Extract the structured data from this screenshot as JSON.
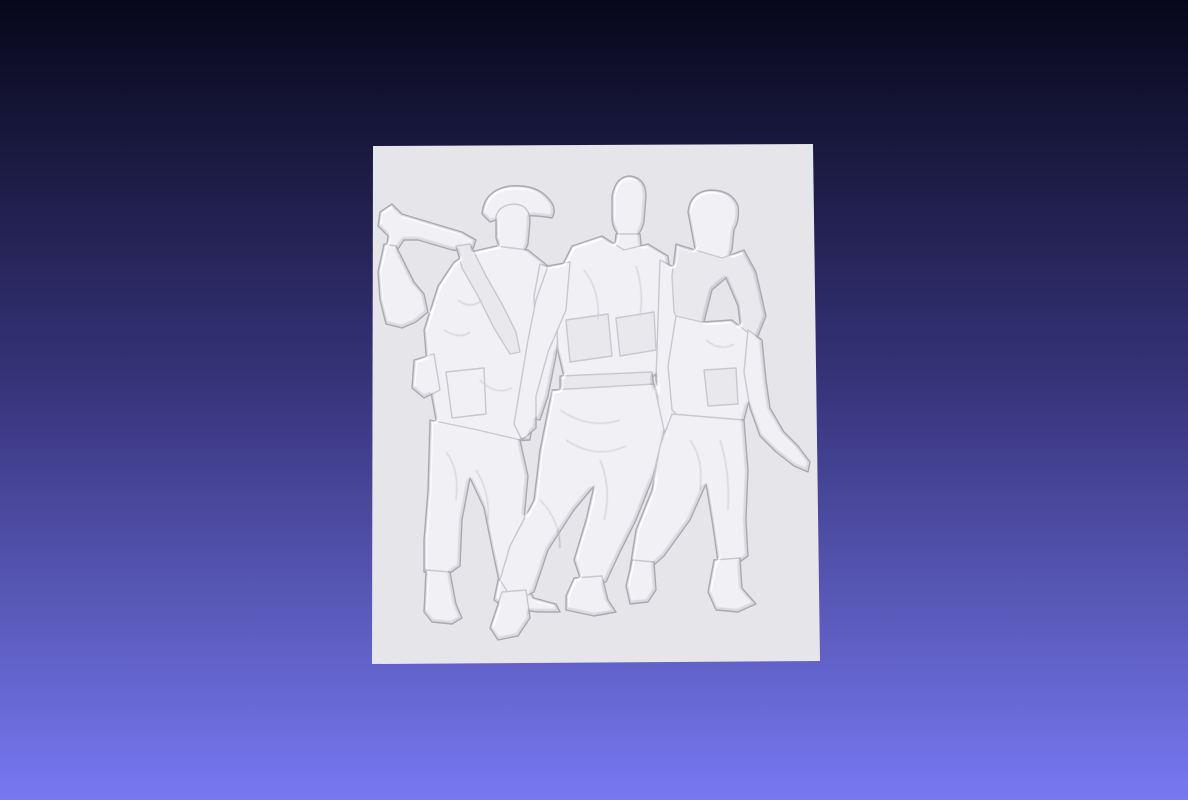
{
  "viewer": {
    "background_top_color": "#07071a",
    "background_bottom_color": "#7878f2"
  },
  "model": {
    "kind": "relief-panel",
    "depicts": "three-soldiers",
    "surface_color": "#e6e6ea",
    "shadow_color": "#a9a9b1"
  }
}
